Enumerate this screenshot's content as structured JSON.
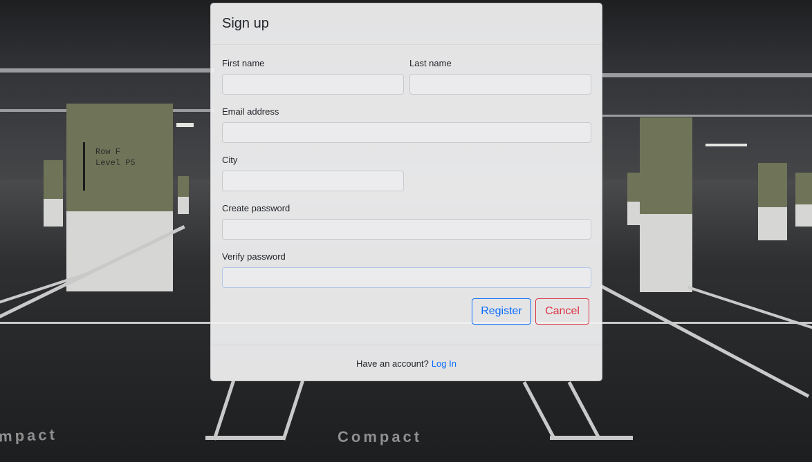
{
  "background": {
    "row_sign_line1": "Row F",
    "row_sign_line2": "Level  P5",
    "floor_text_left": "mpact",
    "floor_text_center": "Compact",
    "accent_color": "#0d6efd",
    "danger_color": "#dc3545"
  },
  "modal": {
    "title": "Sign up",
    "fields": {
      "first_name": {
        "label": "First name",
        "value": "",
        "placeholder": ""
      },
      "last_name": {
        "label": "Last name",
        "value": "",
        "placeholder": ""
      },
      "email": {
        "label": "Email address",
        "value": "",
        "placeholder": ""
      },
      "city": {
        "label": "City",
        "value": "",
        "placeholder": ""
      },
      "create_password": {
        "label": "Create password",
        "value": "",
        "placeholder": ""
      },
      "verify_password": {
        "label": "Verify password",
        "value": "",
        "placeholder": ""
      }
    },
    "buttons": {
      "register": "Register",
      "cancel": "Cancel"
    },
    "footer": {
      "prompt": "Have an account?",
      "login_link": "Log In"
    }
  }
}
